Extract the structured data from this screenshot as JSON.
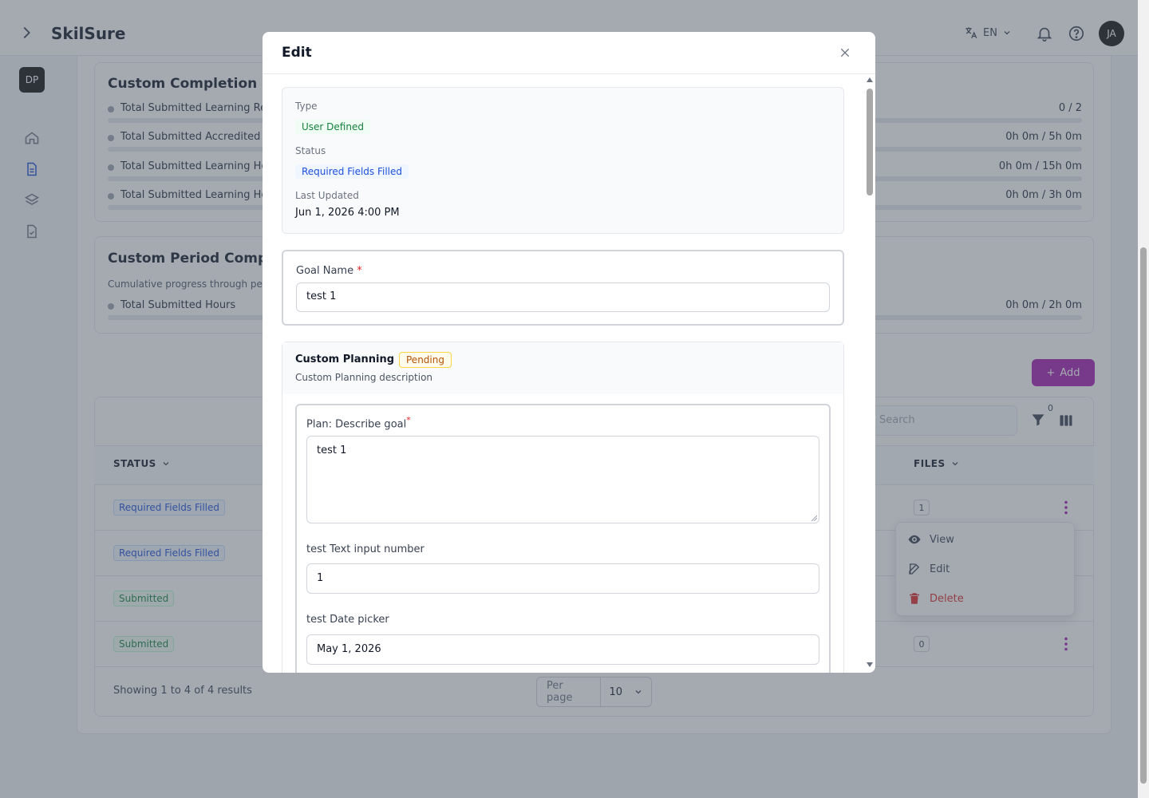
{
  "app": {
    "brand": "SkilSure",
    "lang": "EN",
    "avatar": "JA",
    "org": "DP"
  },
  "nav_icons": [
    "home-icon",
    "document-icon",
    "layers-icon",
    "file-check-icon"
  ],
  "completion": {
    "title": "Custom Completion R",
    "rows": [
      {
        "label": "Total Submitted Learning Re",
        "value": "0 / 2"
      },
      {
        "label": "Total Submitted Accredited I",
        "value": "0h 0m / 5h 0m"
      },
      {
        "label": "Total Submitted Learning Ho",
        "value": "0h 0m / 15h 0m"
      },
      {
        "label": "Total Submitted Learning Ho",
        "value": "0h 0m / 3h 0m"
      }
    ]
  },
  "period": {
    "title": "Custom Period Compl",
    "description": "Cumulative progress through pe",
    "rows": [
      {
        "label": "Total Submitted Hours",
        "value": "0h 0m / 2h 0m"
      }
    ]
  },
  "table": {
    "add_label": "Add",
    "search_placeholder": "Search",
    "filter_count": "0",
    "headers": {
      "status": "STATUS",
      "files": "FILES"
    },
    "rows": [
      {
        "status": "Required Fields Filled",
        "files": "1"
      },
      {
        "status": "Required Fields Filled",
        "files": ""
      },
      {
        "status": "Submitted",
        "files": ""
      },
      {
        "status": "Submitted",
        "files": "0"
      }
    ],
    "menu": {
      "view": "View",
      "edit": "Edit",
      "delete": "Delete"
    },
    "showing": "Showing 1 to 4 of 4 results",
    "per_page_label": "Per page",
    "per_page_value": "10"
  },
  "modal": {
    "title": "Edit",
    "info": {
      "type_label": "Type",
      "type_value": "User Defined",
      "status_label": "Status",
      "status_value": "Required Fields Filled",
      "updated_label": "Last Updated",
      "updated_value": "Jun 1, 2026 4:00 PM"
    },
    "goal": {
      "label": "Goal Name",
      "required": "*",
      "value": "test 1"
    },
    "planning": {
      "title": "Custom Planning",
      "badge": "Pending",
      "description": "Custom Planning description",
      "fields": {
        "describe_label": "Plan: Describe goal",
        "describe_required": "*",
        "describe_value": "test 1",
        "number_label": "test Text input number",
        "number_value": "1",
        "date_label": "test Date picker",
        "date_value": "May 1, 2026"
      }
    }
  },
  "colors": {
    "accent": "#a21caf",
    "danger": "#dc2626",
    "green": "#15803d",
    "blue": "#1d4ed8"
  }
}
